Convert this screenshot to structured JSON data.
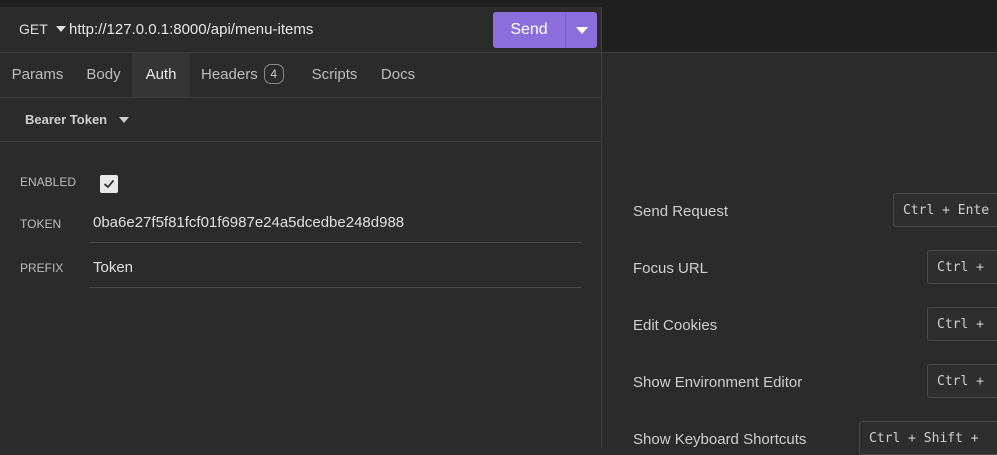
{
  "request": {
    "method": "GET",
    "url": "http://127.0.0.1:8000/api/menu-items",
    "send_label": "Send"
  },
  "tabs": [
    {
      "label": "Params"
    },
    {
      "label": "Body"
    },
    {
      "label": "Auth",
      "active": true
    },
    {
      "label": "Headers",
      "badge": "4"
    },
    {
      "label": "Scripts"
    },
    {
      "label": "Docs"
    }
  ],
  "auth": {
    "type_label": "Bearer Token",
    "enabled_label": "ENABLED",
    "enabled": true,
    "token_label": "TOKEN",
    "token_value": "0ba6e27f5f81fcf01f6987e24a5dcedbe248d988",
    "prefix_label": "PREFIX",
    "prefix_value": "Token"
  },
  "shortcuts": [
    {
      "label": "Send Request",
      "keys": "Ctrl + Ente"
    },
    {
      "label": "Focus URL",
      "keys": "Ctrl +"
    },
    {
      "label": "Edit Cookies",
      "keys": "Ctrl +"
    },
    {
      "label": "Show Environment Editor",
      "keys": "Ctrl +"
    },
    {
      "label": "Show Keyboard Shortcuts",
      "keys": "Ctrl + Shift +"
    }
  ],
  "colors": {
    "accent": "#8a6fdc",
    "background": "#2b2b2b",
    "header_background": "#1f1f1f"
  }
}
